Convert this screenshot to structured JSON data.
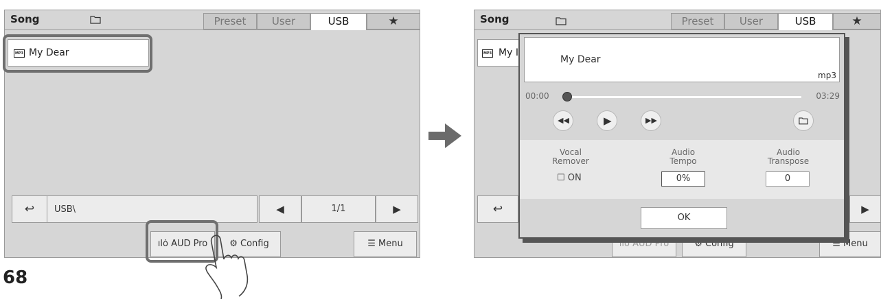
{
  "page_number": "68",
  "left": {
    "title": "Song",
    "tabs": [
      "Preset",
      "User",
      "USB"
    ],
    "active_tab": "USB",
    "files": [
      {
        "name": "My Dear",
        "type": "MP3"
      }
    ],
    "path": "USB\\",
    "page": "1/1",
    "aud_pro_label": "AUD Pro",
    "config_label": "Config",
    "menu_label": "Menu"
  },
  "right": {
    "title": "Song",
    "tabs": [
      "Preset",
      "User",
      "USB"
    ],
    "file_partial": "My I",
    "dialog": {
      "song_name": "My Dear",
      "format": "mp3",
      "time_start": "00:00",
      "time_end": "03:29",
      "progress": 0.0,
      "vocal_label_1": "Vocal",
      "vocal_label_2": "Remover",
      "vocal_value": "ON",
      "tempo_label_1": "Audio",
      "tempo_label_2": "Tempo",
      "tempo_value": "0%",
      "transpose_label_1": "Audio",
      "transpose_label_2": "Transpose",
      "transpose_value": "0",
      "ok_label": "OK"
    },
    "aud_pro_label": "AUD Pro",
    "config_label": "Config",
    "menu_label": "Menu"
  },
  "colors": {
    "screen_bg": "#d6d6d6",
    "highlight": "#6f6f6f",
    "arrow": "#6b6b6b"
  }
}
